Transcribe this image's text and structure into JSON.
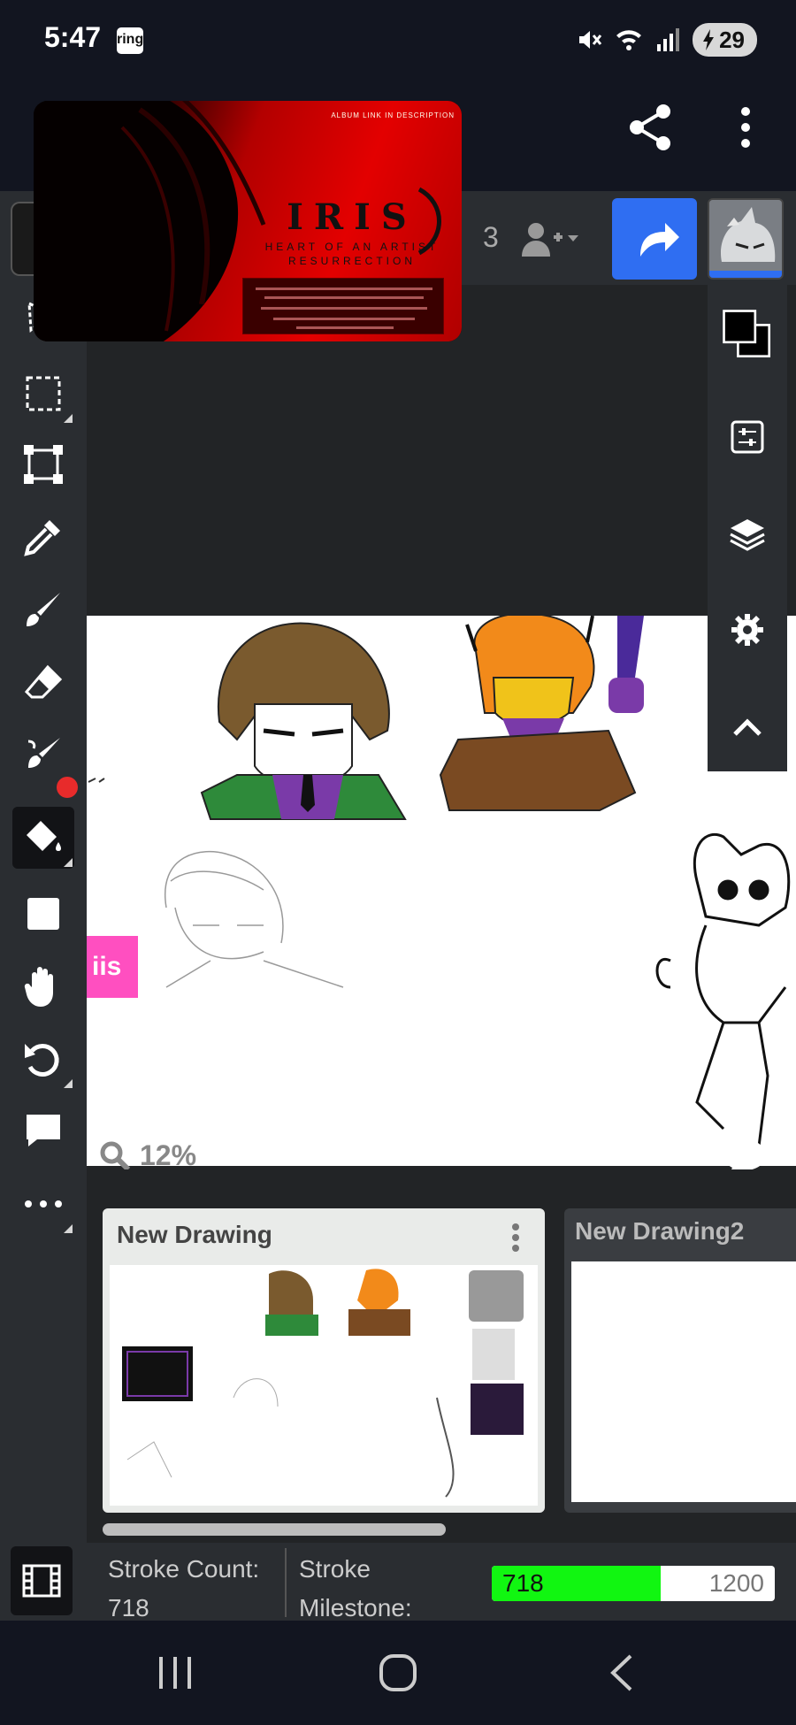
{
  "status_bar": {
    "time": "5:47",
    "ring_label": "ring",
    "battery_level": "29",
    "icons": [
      "mute-icon",
      "wifi-icon",
      "signal-icon",
      "battery-charging-icon"
    ]
  },
  "top_bar": {
    "share_icon": "share-icon",
    "more_icon": "more-vertical-icon"
  },
  "album_card": {
    "title": "IRIS",
    "subtitle_line1": "HEART OF AN ARTIST",
    "subtitle_line2": "RESURRECTION",
    "top_caption": "ALBUM LINK IN DESCRIPTION",
    "accent_color": "#e30000"
  },
  "toolbar": {
    "user_count": "3",
    "add_user_icon": "add-user-icon",
    "share_button_icon": "redo-share-icon",
    "accent_color": "#2f6ef2"
  },
  "tools": [
    {
      "name": "select-arrow-icon"
    },
    {
      "name": "marquee-select-icon"
    },
    {
      "name": "transform-icon"
    },
    {
      "name": "eyedropper-icon"
    },
    {
      "name": "brush-icon"
    },
    {
      "name": "eraser-icon"
    },
    {
      "name": "smudge-brush-icon"
    },
    {
      "name": "fill-bucket-icon",
      "selected": true
    },
    {
      "name": "shape-square-icon"
    },
    {
      "name": "hand-pan-icon"
    },
    {
      "name": "undo-icon"
    },
    {
      "name": "chat-icon"
    },
    {
      "name": "more-horizontal-icon"
    }
  ],
  "canvas": {
    "zoom": "12%",
    "pink_label": "iis"
  },
  "right_panel": {
    "buttons": [
      "color-swatch-icon",
      "adjustments-icon",
      "layers-icon",
      "settings-icon",
      "collapse-icon"
    ]
  },
  "tabs": [
    {
      "title": "New Drawing",
      "active": true
    },
    {
      "title": "New Drawing2",
      "active": false
    }
  ],
  "stroke_bar": {
    "count_label": "Stroke Count:",
    "count_value": "718",
    "milestone_label_1": "Stroke",
    "milestone_label_2": "Milestone:",
    "progress_value": "718",
    "progress_max": "1200",
    "progress_fraction": 0.598
  },
  "nav_bar": {
    "buttons": [
      "recent-apps-icon",
      "home-icon",
      "back-icon"
    ]
  }
}
